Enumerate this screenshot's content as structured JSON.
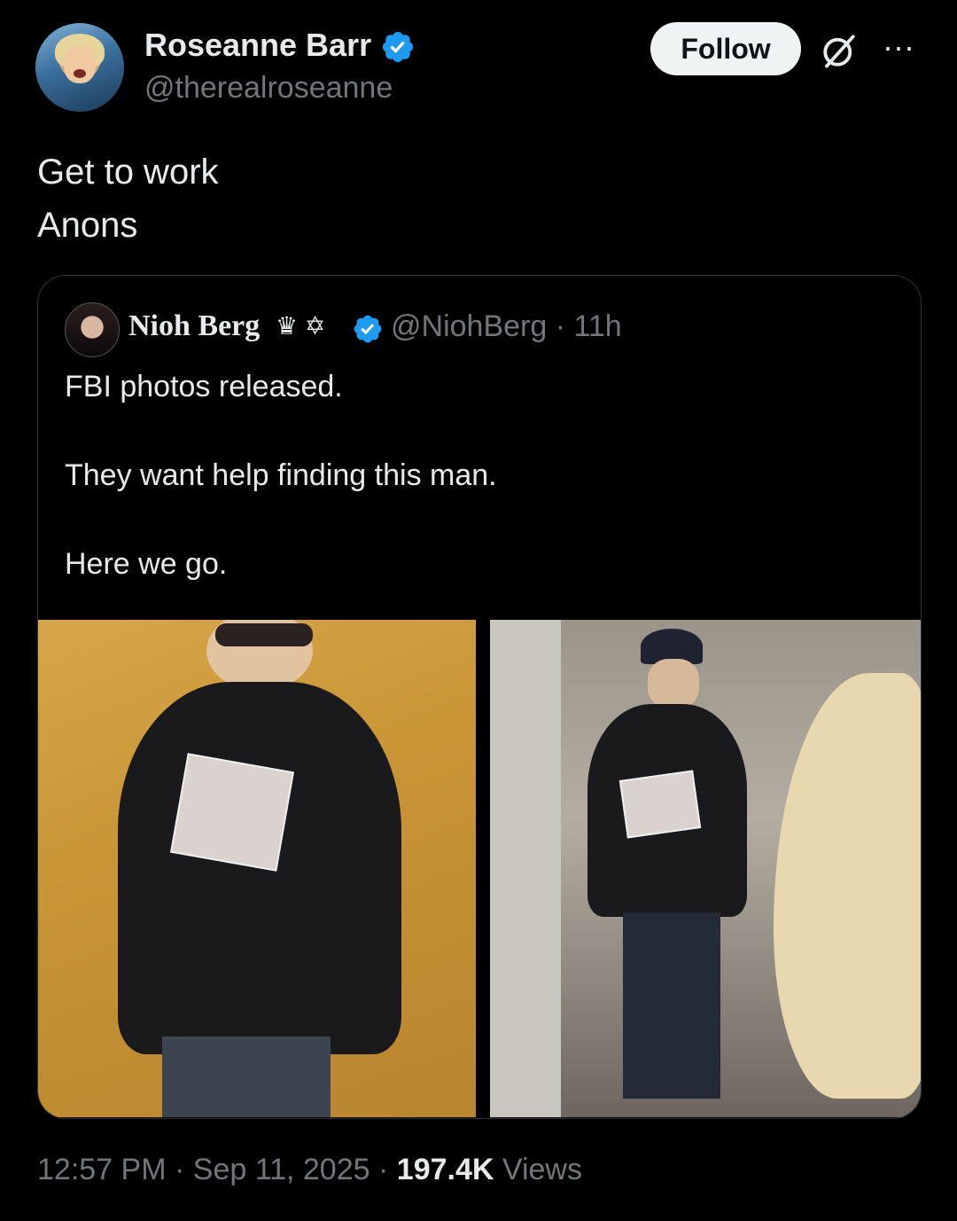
{
  "author": {
    "name": "Roseanne Barr",
    "handle": "@therealroseanne",
    "verified_color": "#1d9bf0"
  },
  "actions": {
    "follow_label": "Follow",
    "grok_icon": "grok-icon",
    "more_label": "···"
  },
  "tweet": {
    "text": "Get to work\nAnons"
  },
  "quoted": {
    "name": "Nioh Berg",
    "emoji": "♛ ✡",
    "handle": "@NiohBerg",
    "time": "· 11h",
    "text": "FBI photos released.\n\nThey want help finding this man.\n\nHere we go."
  },
  "footer": {
    "time": "12:57 PM",
    "sep1": "·",
    "date": "Sep 11, 2025",
    "sep2": "·",
    "views_count": "197.4K",
    "views_label": "Views"
  }
}
